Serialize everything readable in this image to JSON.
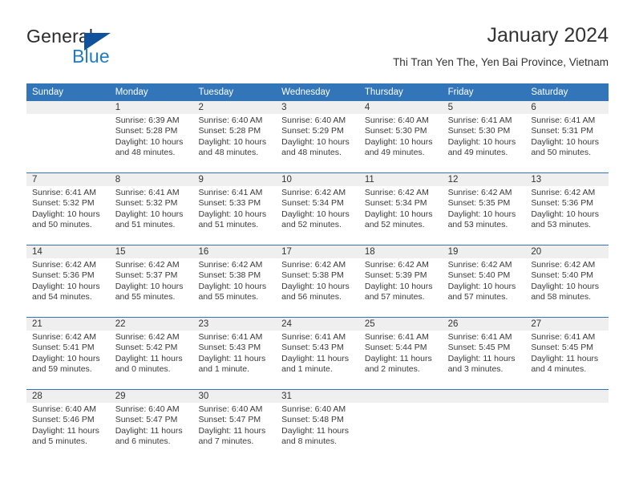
{
  "brand": {
    "name_part1": "General",
    "name_part2": "Blue",
    "accent_color": "#1e7bc4",
    "triangle_color": "#10529b"
  },
  "header": {
    "title": "January 2024",
    "subtitle": "Thi Tran Yen The, Yen Bai Province, Vietnam"
  },
  "calendar": {
    "header_color": "#3275b8",
    "band_color": "#efefef",
    "day_names": [
      "Sunday",
      "Monday",
      "Tuesday",
      "Wednesday",
      "Thursday",
      "Friday",
      "Saturday"
    ],
    "weeks": [
      [
        {
          "day": "",
          "sunrise": "",
          "sunset": "",
          "daylight": "",
          "daylight2": ""
        },
        {
          "day": "1",
          "sunrise": "Sunrise: 6:39 AM",
          "sunset": "Sunset: 5:28 PM",
          "daylight": "Daylight: 10 hours",
          "daylight2": "and 48 minutes."
        },
        {
          "day": "2",
          "sunrise": "Sunrise: 6:40 AM",
          "sunset": "Sunset: 5:28 PM",
          "daylight": "Daylight: 10 hours",
          "daylight2": "and 48 minutes."
        },
        {
          "day": "3",
          "sunrise": "Sunrise: 6:40 AM",
          "sunset": "Sunset: 5:29 PM",
          "daylight": "Daylight: 10 hours",
          "daylight2": "and 48 minutes."
        },
        {
          "day": "4",
          "sunrise": "Sunrise: 6:40 AM",
          "sunset": "Sunset: 5:30 PM",
          "daylight": "Daylight: 10 hours",
          "daylight2": "and 49 minutes."
        },
        {
          "day": "5",
          "sunrise": "Sunrise: 6:41 AM",
          "sunset": "Sunset: 5:30 PM",
          "daylight": "Daylight: 10 hours",
          "daylight2": "and 49 minutes."
        },
        {
          "day": "6",
          "sunrise": "Sunrise: 6:41 AM",
          "sunset": "Sunset: 5:31 PM",
          "daylight": "Daylight: 10 hours",
          "daylight2": "and 50 minutes."
        }
      ],
      [
        {
          "day": "7",
          "sunrise": "Sunrise: 6:41 AM",
          "sunset": "Sunset: 5:32 PM",
          "daylight": "Daylight: 10 hours",
          "daylight2": "and 50 minutes."
        },
        {
          "day": "8",
          "sunrise": "Sunrise: 6:41 AM",
          "sunset": "Sunset: 5:32 PM",
          "daylight": "Daylight: 10 hours",
          "daylight2": "and 51 minutes."
        },
        {
          "day": "9",
          "sunrise": "Sunrise: 6:41 AM",
          "sunset": "Sunset: 5:33 PM",
          "daylight": "Daylight: 10 hours",
          "daylight2": "and 51 minutes."
        },
        {
          "day": "10",
          "sunrise": "Sunrise: 6:42 AM",
          "sunset": "Sunset: 5:34 PM",
          "daylight": "Daylight: 10 hours",
          "daylight2": "and 52 minutes."
        },
        {
          "day": "11",
          "sunrise": "Sunrise: 6:42 AM",
          "sunset": "Sunset: 5:34 PM",
          "daylight": "Daylight: 10 hours",
          "daylight2": "and 52 minutes."
        },
        {
          "day": "12",
          "sunrise": "Sunrise: 6:42 AM",
          "sunset": "Sunset: 5:35 PM",
          "daylight": "Daylight: 10 hours",
          "daylight2": "and 53 minutes."
        },
        {
          "day": "13",
          "sunrise": "Sunrise: 6:42 AM",
          "sunset": "Sunset: 5:36 PM",
          "daylight": "Daylight: 10 hours",
          "daylight2": "and 53 minutes."
        }
      ],
      [
        {
          "day": "14",
          "sunrise": "Sunrise: 6:42 AM",
          "sunset": "Sunset: 5:36 PM",
          "daylight": "Daylight: 10 hours",
          "daylight2": "and 54 minutes."
        },
        {
          "day": "15",
          "sunrise": "Sunrise: 6:42 AM",
          "sunset": "Sunset: 5:37 PM",
          "daylight": "Daylight: 10 hours",
          "daylight2": "and 55 minutes."
        },
        {
          "day": "16",
          "sunrise": "Sunrise: 6:42 AM",
          "sunset": "Sunset: 5:38 PM",
          "daylight": "Daylight: 10 hours",
          "daylight2": "and 55 minutes."
        },
        {
          "day": "17",
          "sunrise": "Sunrise: 6:42 AM",
          "sunset": "Sunset: 5:38 PM",
          "daylight": "Daylight: 10 hours",
          "daylight2": "and 56 minutes."
        },
        {
          "day": "18",
          "sunrise": "Sunrise: 6:42 AM",
          "sunset": "Sunset: 5:39 PM",
          "daylight": "Daylight: 10 hours",
          "daylight2": "and 57 minutes."
        },
        {
          "day": "19",
          "sunrise": "Sunrise: 6:42 AM",
          "sunset": "Sunset: 5:40 PM",
          "daylight": "Daylight: 10 hours",
          "daylight2": "and 57 minutes."
        },
        {
          "day": "20",
          "sunrise": "Sunrise: 6:42 AM",
          "sunset": "Sunset: 5:40 PM",
          "daylight": "Daylight: 10 hours",
          "daylight2": "and 58 minutes."
        }
      ],
      [
        {
          "day": "21",
          "sunrise": "Sunrise: 6:42 AM",
          "sunset": "Sunset: 5:41 PM",
          "daylight": "Daylight: 10 hours",
          "daylight2": "and 59 minutes."
        },
        {
          "day": "22",
          "sunrise": "Sunrise: 6:42 AM",
          "sunset": "Sunset: 5:42 PM",
          "daylight": "Daylight: 11 hours",
          "daylight2": "and 0 minutes."
        },
        {
          "day": "23",
          "sunrise": "Sunrise: 6:41 AM",
          "sunset": "Sunset: 5:43 PM",
          "daylight": "Daylight: 11 hours",
          "daylight2": "and 1 minute."
        },
        {
          "day": "24",
          "sunrise": "Sunrise: 6:41 AM",
          "sunset": "Sunset: 5:43 PM",
          "daylight": "Daylight: 11 hours",
          "daylight2": "and 1 minute."
        },
        {
          "day": "25",
          "sunrise": "Sunrise: 6:41 AM",
          "sunset": "Sunset: 5:44 PM",
          "daylight": "Daylight: 11 hours",
          "daylight2": "and 2 minutes."
        },
        {
          "day": "26",
          "sunrise": "Sunrise: 6:41 AM",
          "sunset": "Sunset: 5:45 PM",
          "daylight": "Daylight: 11 hours",
          "daylight2": "and 3 minutes."
        },
        {
          "day": "27",
          "sunrise": "Sunrise: 6:41 AM",
          "sunset": "Sunset: 5:45 PM",
          "daylight": "Daylight: 11 hours",
          "daylight2": "and 4 minutes."
        }
      ],
      [
        {
          "day": "28",
          "sunrise": "Sunrise: 6:40 AM",
          "sunset": "Sunset: 5:46 PM",
          "daylight": "Daylight: 11 hours",
          "daylight2": "and 5 minutes."
        },
        {
          "day": "29",
          "sunrise": "Sunrise: 6:40 AM",
          "sunset": "Sunset: 5:47 PM",
          "daylight": "Daylight: 11 hours",
          "daylight2": "and 6 minutes."
        },
        {
          "day": "30",
          "sunrise": "Sunrise: 6:40 AM",
          "sunset": "Sunset: 5:47 PM",
          "daylight": "Daylight: 11 hours",
          "daylight2": "and 7 minutes."
        },
        {
          "day": "31",
          "sunrise": "Sunrise: 6:40 AM",
          "sunset": "Sunset: 5:48 PM",
          "daylight": "Daylight: 11 hours",
          "daylight2": "and 8 minutes."
        },
        {
          "day": "",
          "sunrise": "",
          "sunset": "",
          "daylight": "",
          "daylight2": ""
        },
        {
          "day": "",
          "sunrise": "",
          "sunset": "",
          "daylight": "",
          "daylight2": ""
        },
        {
          "day": "",
          "sunrise": "",
          "sunset": "",
          "daylight": "",
          "daylight2": ""
        }
      ]
    ]
  }
}
